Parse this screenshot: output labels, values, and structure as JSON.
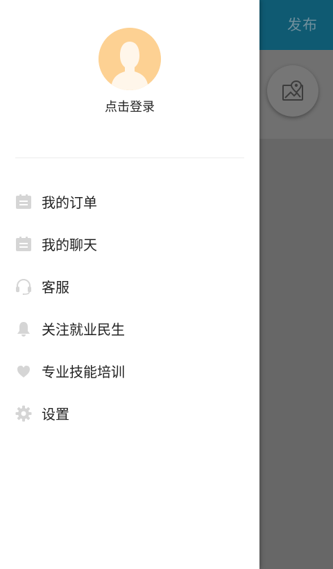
{
  "background": {
    "header_action": "发布"
  },
  "drawer": {
    "login_text": "点击登录",
    "menu": [
      {
        "label": "我的订单",
        "icon": "clipboard-icon"
      },
      {
        "label": "我的聊天",
        "icon": "clipboard-icon"
      },
      {
        "label": "客服",
        "icon": "headset-icon"
      },
      {
        "label": "关注就业民生",
        "icon": "bell-icon"
      },
      {
        "label": "专业技能培训",
        "icon": "heart-icon"
      },
      {
        "label": "设置",
        "icon": "gear-icon"
      }
    ]
  },
  "colors": {
    "header": "#0f5a72",
    "overlay": "#676767",
    "avatar_bg": "#fdd193",
    "icon_gray": "#d5d5d5"
  }
}
